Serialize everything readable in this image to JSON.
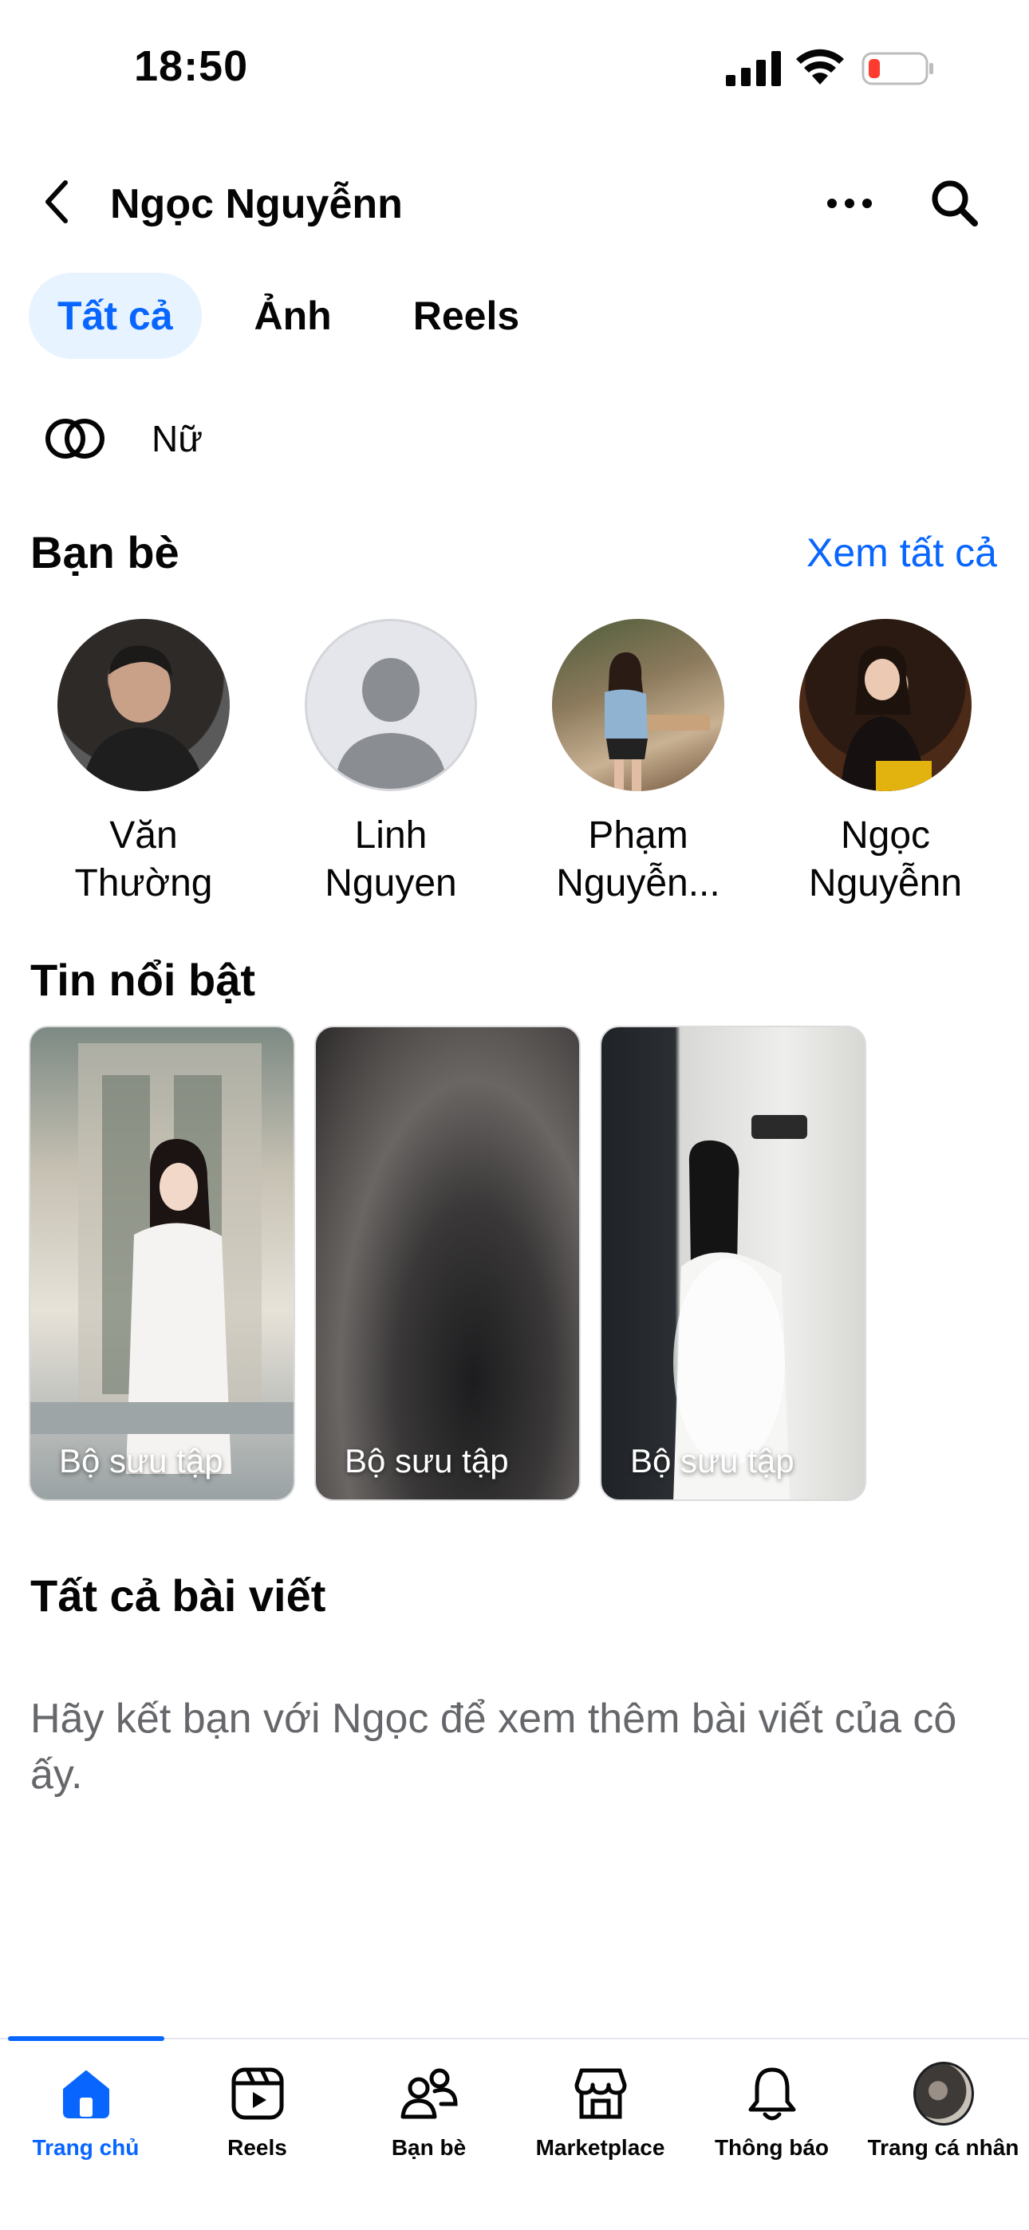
{
  "status_bar": {
    "time": "18:50"
  },
  "header": {
    "profile_name": "Ngọc Nguyễnn"
  },
  "tabs": [
    {
      "label": "Tất cả",
      "active": true
    },
    {
      "label": "Ảnh",
      "active": false
    },
    {
      "label": "Reels",
      "active": false
    }
  ],
  "gender": {
    "label": "Nữ",
    "icon": "gender-rings-icon"
  },
  "friends_section": {
    "title": "Bạn bè",
    "see_all": "Xem tất cả",
    "friends": [
      {
        "line1": "Văn",
        "line2": "Thường"
      },
      {
        "line1": "Linh",
        "line2": "Nguyen"
      },
      {
        "line1": "Phạm",
        "line2": "Nguyễn..."
      },
      {
        "line1": "Ngọc",
        "line2": "Nguyễnn"
      }
    ]
  },
  "highlights_section": {
    "title": "Tin nổi bật",
    "items": [
      {
        "label": "Bộ sưu tập"
      },
      {
        "label": "Bộ sưu tập"
      },
      {
        "label": "Bộ sưu tập"
      }
    ]
  },
  "posts_section": {
    "title": "Tất cả bài viết",
    "empty_message": "Hãy kết bạn với Ngọc để xem thêm bài viết của cô ấy."
  },
  "bottom_nav": {
    "items": [
      {
        "label": "Trang chủ",
        "icon": "home-icon",
        "active": true
      },
      {
        "label": "Reels",
        "icon": "reels-icon",
        "active": false
      },
      {
        "label": "Bạn bè",
        "icon": "friends-icon",
        "active": false
      },
      {
        "label": "Marketplace",
        "icon": "marketplace-icon",
        "active": false
      },
      {
        "label": "Thông báo",
        "icon": "bell-icon",
        "active": false
      },
      {
        "label": "Trang cá nhân",
        "icon": "profile-avatar",
        "active": false
      }
    ]
  },
  "colors": {
    "accent": "#0866ff",
    "accent_bg": "#e7f3ff",
    "secondary_text": "#65676b"
  }
}
